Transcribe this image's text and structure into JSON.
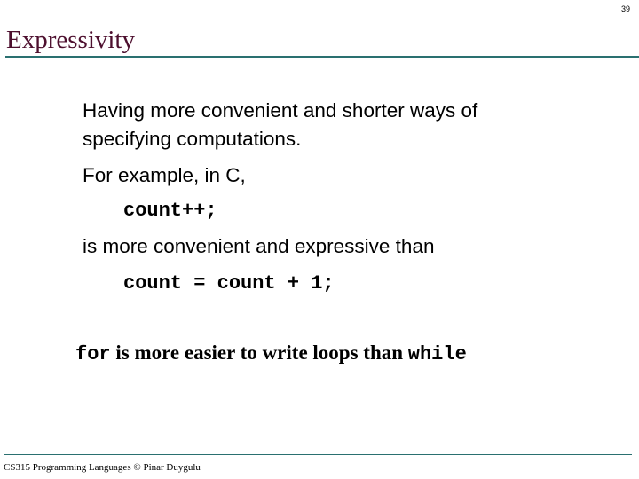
{
  "slide": {
    "page_number": "39",
    "title": "Expressivity",
    "body": {
      "line1": "Having more convenient and shorter ways of",
      "line2": "specifying computations.",
      "line3": "For example, in C,",
      "code1": "count++;",
      "line4": "is more convenient and expressive than",
      "code2": "count = count + 1;"
    },
    "note": {
      "keyword1": "for",
      "text": " is more easier to write loops than ",
      "keyword2": "while"
    },
    "footer": "CS315 Programming Languages © Pinar Duygulu",
    "colors": {
      "title": "#4d0f2e",
      "rule": "#2a7070"
    }
  }
}
